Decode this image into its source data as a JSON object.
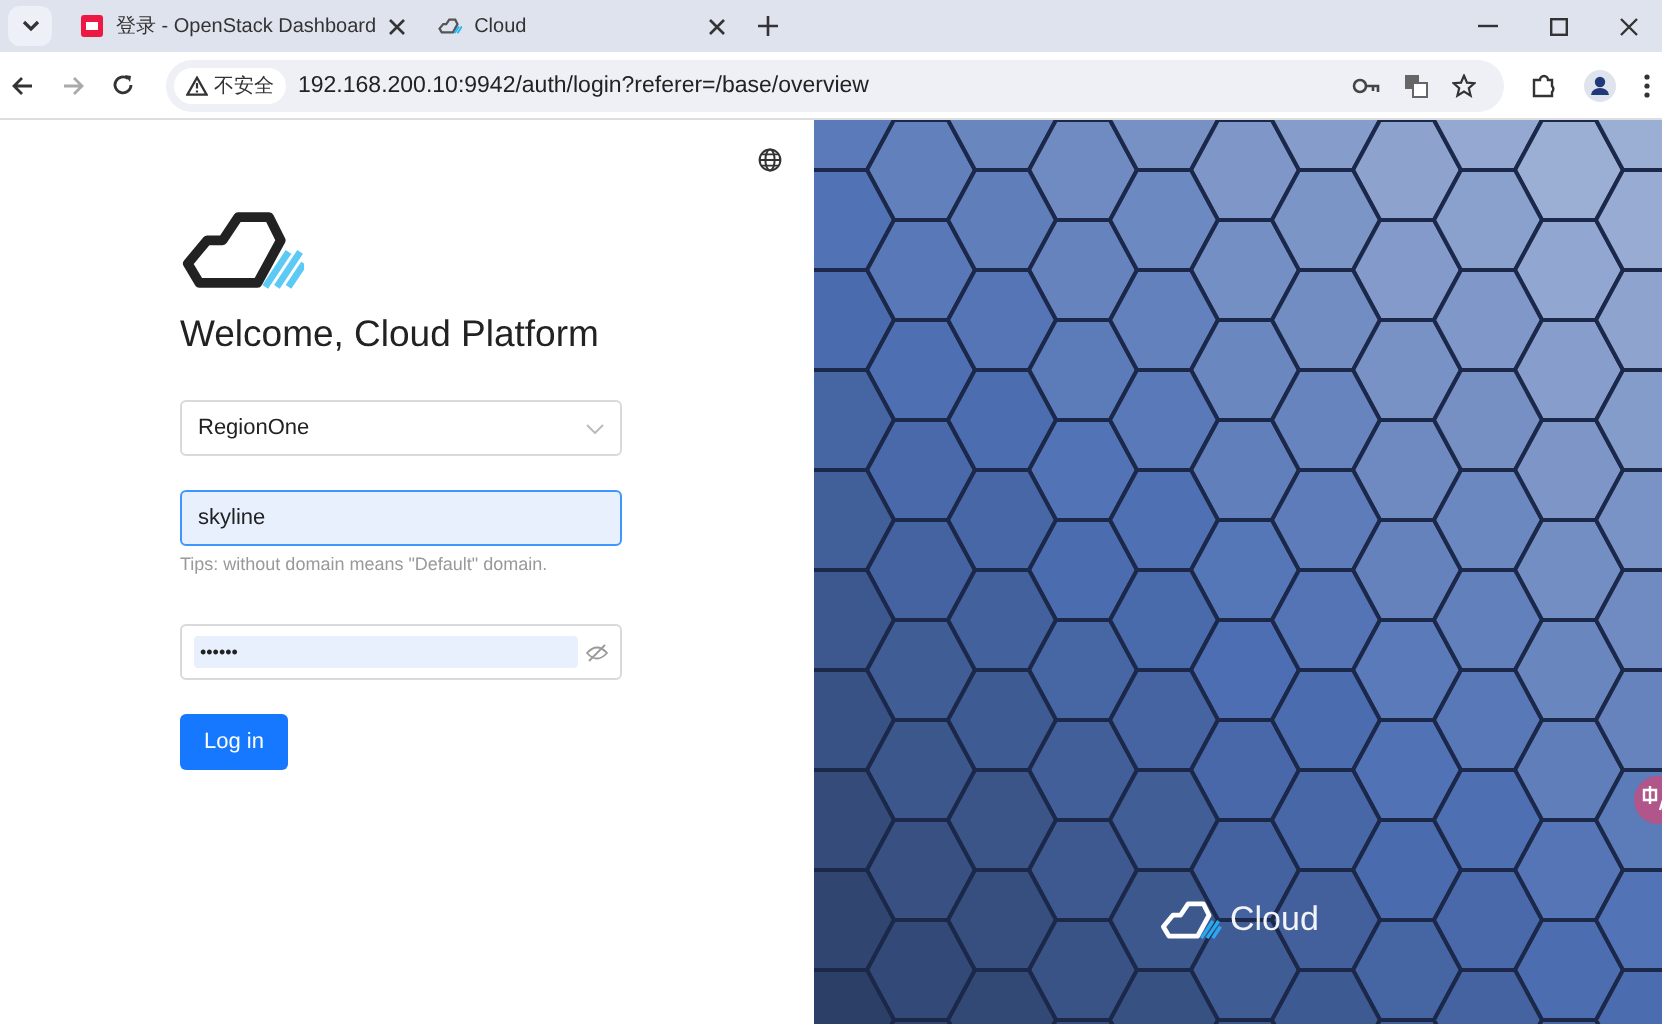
{
  "browser": {
    "tabs": [
      {
        "kind": "openstack",
        "title": "登录 - OpenStack Dashboard",
        "selected": false
      },
      {
        "kind": "cloud",
        "title": "Cloud",
        "selected": true
      }
    ],
    "security_label": "不安全",
    "url": "192.168.200.10:9942/auth/login?referer=/base/overview"
  },
  "login": {
    "heading": "Welcome, Cloud Platform",
    "region": {
      "value": "RegionOne"
    },
    "username": {
      "value": "skyline",
      "focused": true
    },
    "tip": "Tips: without domain means \"Default\" domain.",
    "password": {
      "value": "••••••"
    },
    "button": "Log in"
  },
  "hero": {
    "brand": "Cloud"
  }
}
